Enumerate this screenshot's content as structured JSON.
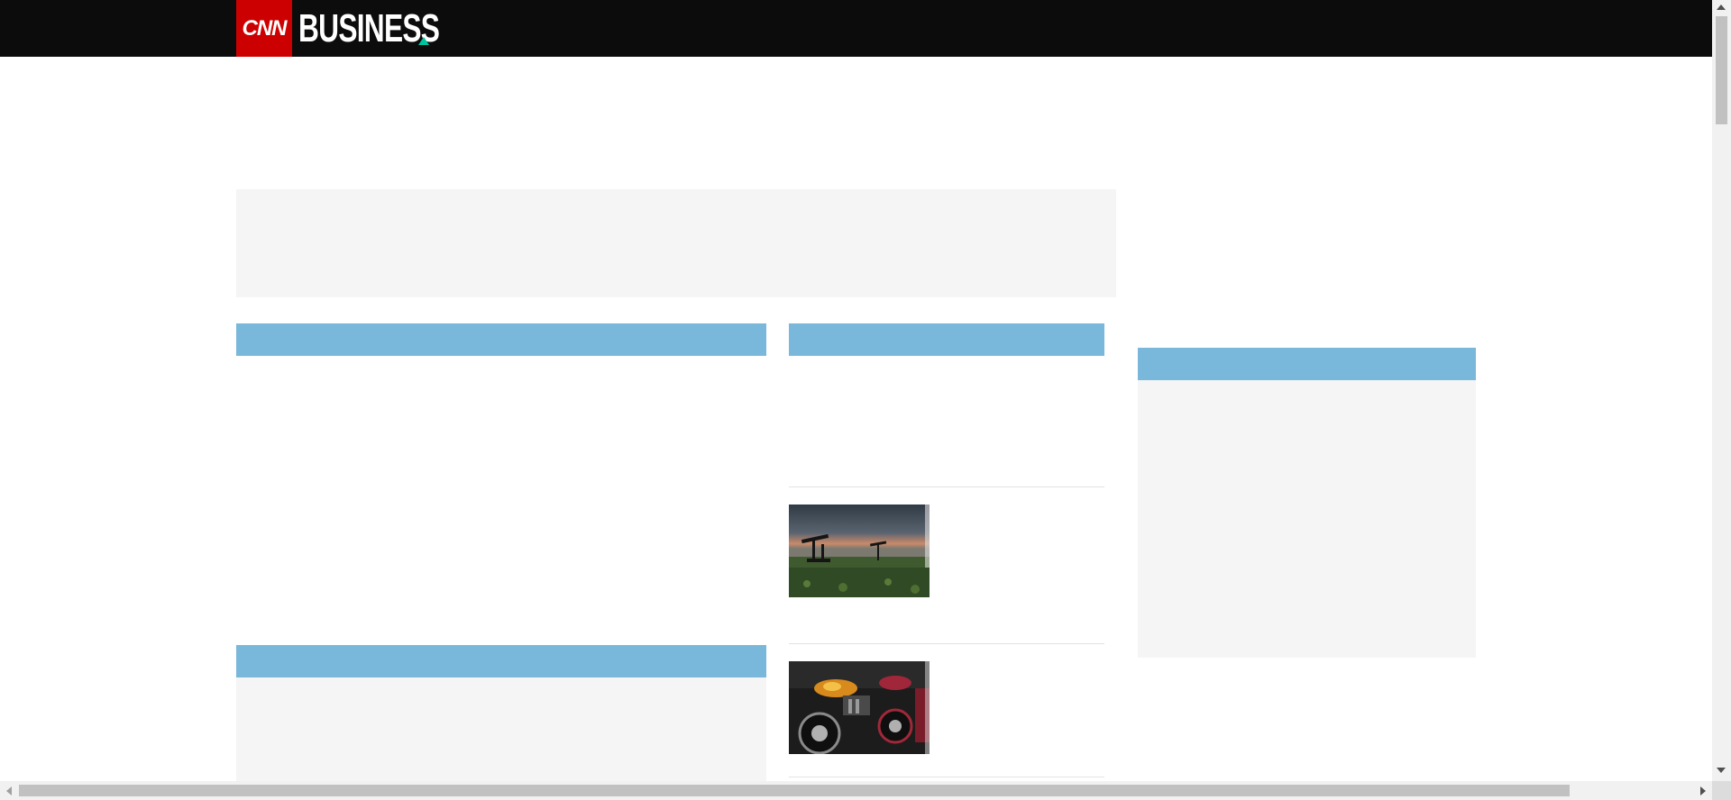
{
  "header": {
    "logo_text": "CNN",
    "section_title": "BUSINESS",
    "colors": {
      "background": "#0c0c0c",
      "logo_red": "#cc0000",
      "accent_triangle": "#00c4a0"
    }
  },
  "layout_colors": {
    "section_header": "#79b7db",
    "placeholder": "#f5f5f5"
  },
  "thumbnails": [
    {
      "icon": "oil-pumpjack-photo"
    },
    {
      "icon": "motorcycles-photo"
    }
  ]
}
